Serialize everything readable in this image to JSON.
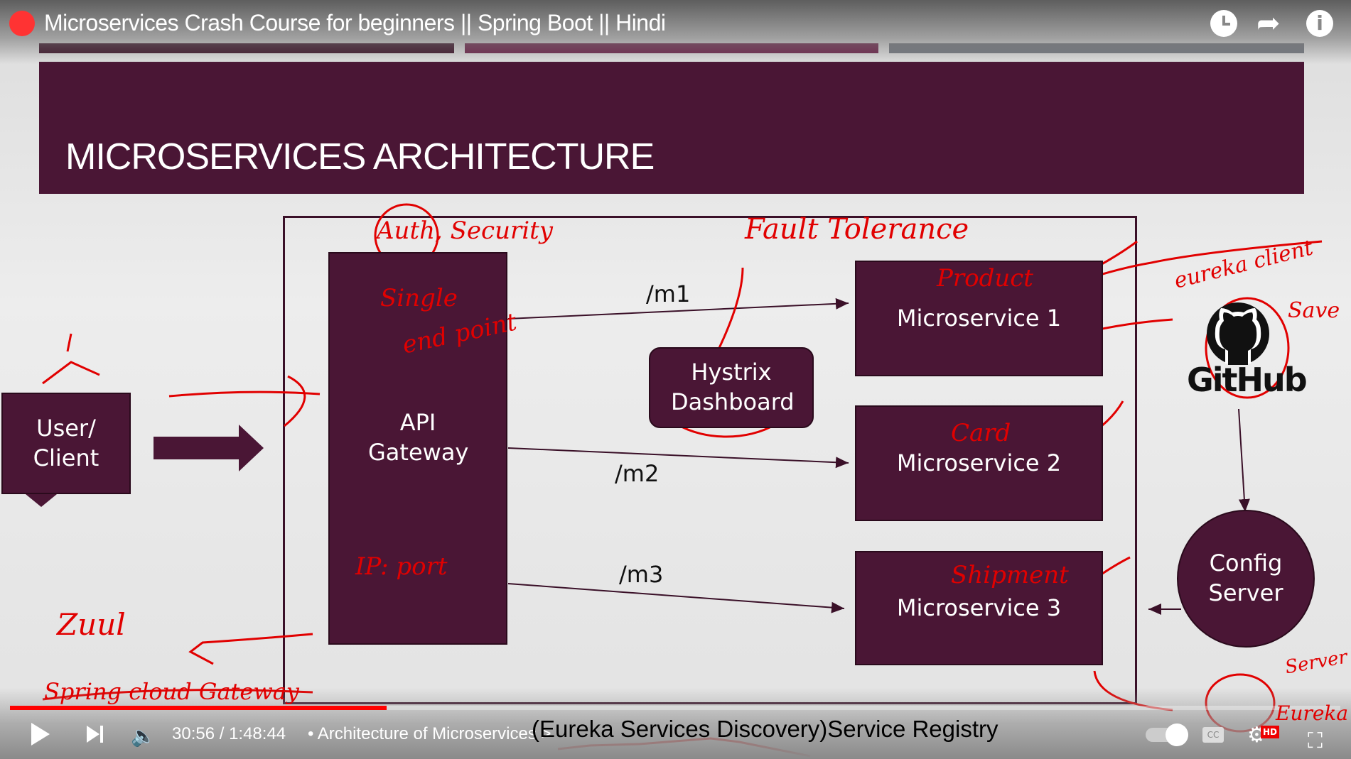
{
  "player": {
    "title": "Microservices Crash Course for beginners || Spring Boot || Hindi",
    "time": "30:56 / 1:48:44",
    "chapter": "• Architecture of Microservices >",
    "caption": "(Eureka Services Discovery)Service Registry",
    "progress_percent": 28.3,
    "icons": [
      "watch-later-icon",
      "share-icon",
      "info-icon",
      "play-icon",
      "next-icon",
      "volume-icon",
      "autoplay-toggle",
      "cc-icon",
      "settings-icon",
      "fullscreen-exit-icon"
    ],
    "hd_badge": "HD"
  },
  "slide": {
    "bar_colors": [
      "#3a0f26",
      "#6d2149",
      "#747880"
    ],
    "title": "MICROSERVICES ARCHITECTURE",
    "user_client": "User/ Client",
    "api_gateway": "API Gateway",
    "hystrix": "Hystrix Dashboard",
    "services": [
      "Microservice 1",
      "Microservice 2",
      "Microservice 3"
    ],
    "routes": [
      "/m1",
      "/m2",
      "/m3"
    ],
    "github": "GitHub",
    "config_server": "Config Server",
    "accent": "#4a1635"
  },
  "annotations": {
    "auth": "Auth, Security",
    "single": "Single",
    "end_point": "end point",
    "fault": "Fault Tolerance",
    "product": "Product",
    "card": "Card",
    "shipment": "Shipment",
    "ip_port": "IP: port",
    "zuul": "Zuul",
    "gateway": "Spring cloud Gateway",
    "eureka_client": "eureka client",
    "save": "Save",
    "server": "Server",
    "eureka": "Eureka"
  }
}
